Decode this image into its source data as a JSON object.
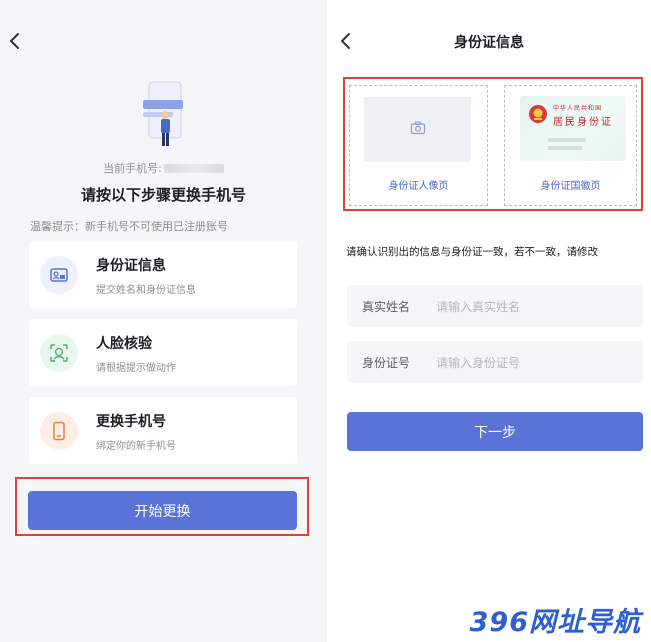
{
  "left": {
    "current_phone_label": "当前手机号:",
    "title": "请按以下步骤更换手机号",
    "tip": "温馨提示：新手机号不可使用已注册账号",
    "steps": [
      {
        "title": "身份证信息",
        "subtitle": "提交姓名和身份证信息",
        "icon": "id-card-icon"
      },
      {
        "title": "人脸核验",
        "subtitle": "请根据提示做动作",
        "icon": "face-scan-icon"
      },
      {
        "title": "更换手机号",
        "subtitle": "绑定你的新手机号",
        "icon": "phone-icon"
      }
    ],
    "start_button": "开始更换"
  },
  "right": {
    "title": "身份证信息",
    "id_front_label": "身份证人像页",
    "id_back_label": "身份证国徽页",
    "emblem_card": {
      "line1": "中华人民共和国",
      "line2": "居民身份证"
    },
    "confirm_text": "请确认识别出的信息与身份证一致，若不一致，请修改",
    "name_field": {
      "label": "真实姓名",
      "placeholder": "请输入真实姓名"
    },
    "id_field": {
      "label": "身份证号",
      "placeholder": "请输入身份证号"
    },
    "next_button": "下一步"
  },
  "watermark": "396网址导航",
  "colors": {
    "primary": "#5a73d6",
    "highlight_border": "#e23e3a"
  }
}
